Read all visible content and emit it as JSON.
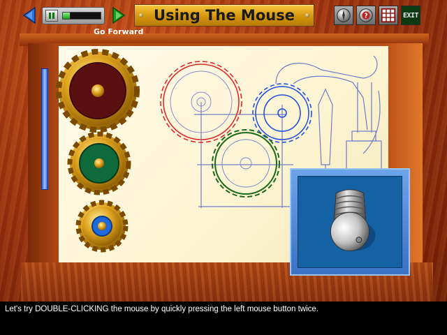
{
  "header": {
    "title": "Using The Mouse",
    "hint_label": "Go Forward"
  },
  "navigation": {
    "back_icon": "left-arrow-icon",
    "forward_icon": "right-arrow-icon",
    "pause_icon": "pause-icon"
  },
  "progress": {
    "value_percent": 18
  },
  "toolbar": {
    "buttons": [
      {
        "icon": "compass-icon"
      },
      {
        "icon": "help-icon"
      },
      {
        "icon": "grid-menu-icon"
      },
      {
        "icon": "exit-icon",
        "label": "EXIT"
      }
    ]
  },
  "instruction": {
    "text": "Let's try DOUBLE-CLICKING the mouse by quickly pressing the left mouse button twice."
  },
  "colors": {
    "wood_base": "#9c3410",
    "paper": "#fdf4d2",
    "blue_panel": "#1462a4",
    "gear_red": "#e02a2a",
    "gear_blue": "#2050e0",
    "gear_green": "#1a6a1a",
    "exit_green": "#0c3a10"
  }
}
